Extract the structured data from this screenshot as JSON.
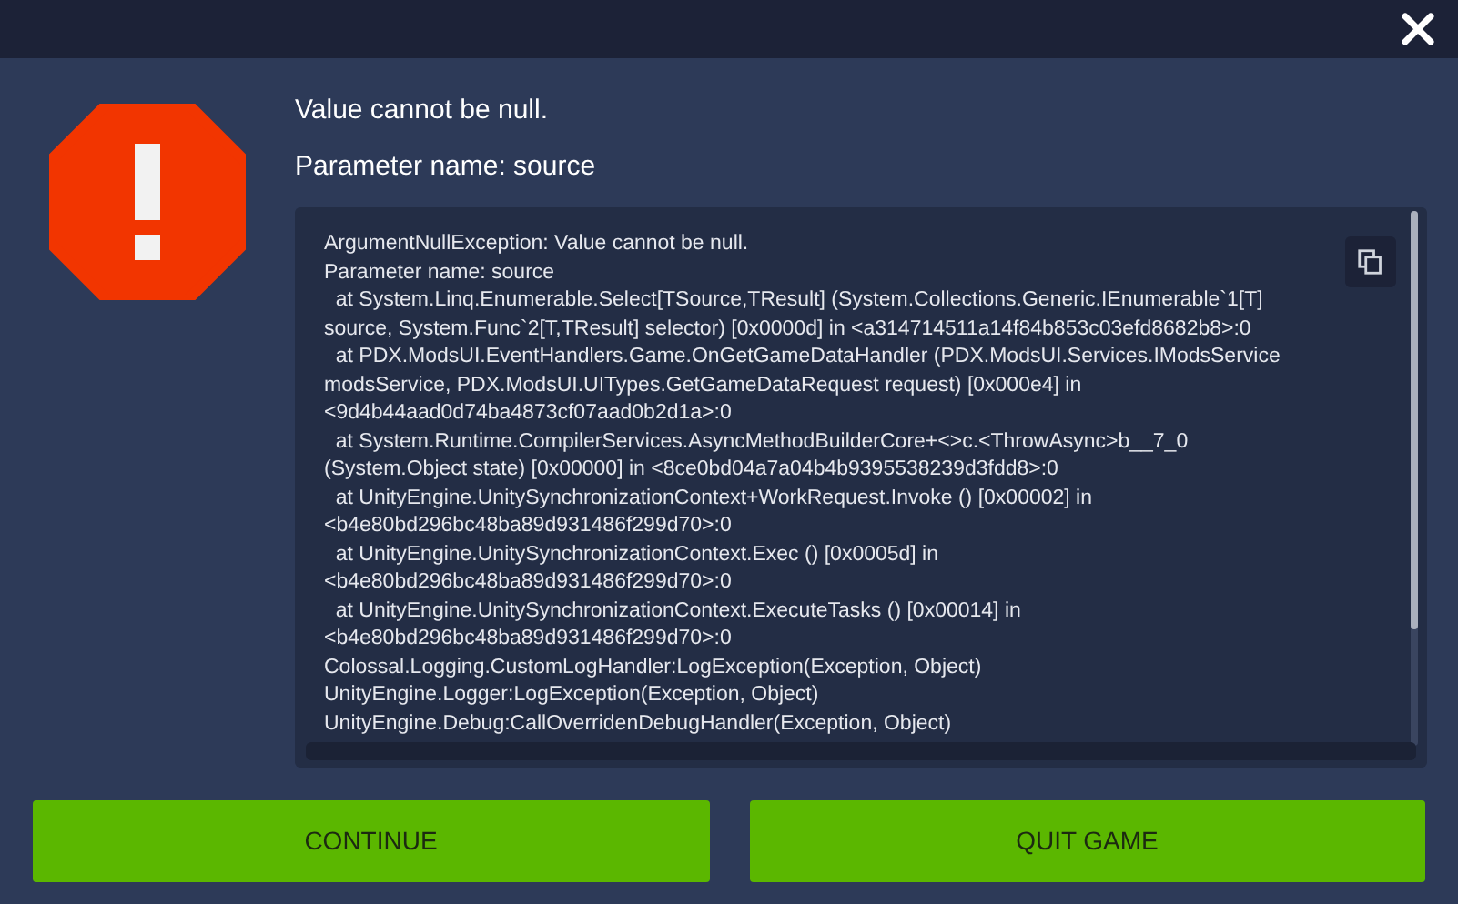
{
  "message": "Value cannot be null.",
  "parameter": "Parameter name: source",
  "log_lines": [
    "ArgumentNullException: Value cannot be null.",
    "Parameter name: source",
    "  at System.Linq.Enumerable.Select[TSource,TResult] (System.Collections.Generic.IEnumerable`1[T]",
    "source, System.Func`2[T,TResult] selector) [0x0000d] in <a314714511a14f84b853c03efd8682b8>:0",
    "  at PDX.ModsUI.EventHandlers.Game.OnGetGameDataHandler (PDX.ModsUI.Services.IModsService",
    "modsService, PDX.ModsUI.UITypes.GetGameDataRequest request) [0x000e4] in",
    "<9d4b44aad0d74ba4873cf07aad0b2d1a>:0",
    "  at System.Runtime.CompilerServices.AsyncMethodBuilderCore+<>c.<ThrowAsync>b__7_0",
    "(System.Object state) [0x00000] in <8ce0bd04a7a04b4b9395538239d3fdd8>:0",
    "  at UnityEngine.UnitySynchronizationContext+WorkRequest.Invoke () [0x00002] in",
    "<b4e80bd296bc48ba89d931486f299d70>:0",
    "  at UnityEngine.UnitySynchronizationContext.Exec () [0x0005d] in",
    "<b4e80bd296bc48ba89d931486f299d70>:0",
    "  at UnityEngine.UnitySynchronizationContext.ExecuteTasks () [0x00014] in",
    "<b4e80bd296bc48ba89d931486f299d70>:0",
    "Colossal.Logging.CustomLogHandler:LogException(Exception, Object)",
    "UnityEngine.Logger:LogException(Exception, Object)",
    "UnityEngine.Debug:CallOverridenDebugHandler(Exception, Object)"
  ],
  "buttons": [
    "CONTINUE",
    "QUIT GAME"
  ]
}
